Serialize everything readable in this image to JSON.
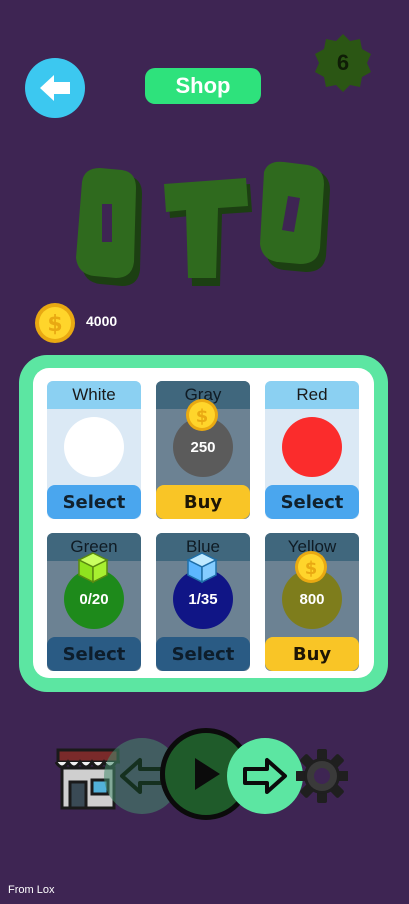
{
  "header": {
    "back_icon": "arrow-left-icon",
    "title": "Shop",
    "level": "6"
  },
  "logo": {
    "text": "OTO"
  },
  "balance": {
    "coins": "4000"
  },
  "colors": {
    "background": "#3e2553",
    "panel_border": "#5ce6a2",
    "select": "#4aa6ee",
    "buy": "#f9c526",
    "logo": "#2f6a1e"
  },
  "items": [
    {
      "name": "White",
      "swatch": "#ffffff",
      "value": "",
      "action": "Select",
      "locked": false,
      "badge": ""
    },
    {
      "name": "Gray",
      "swatch": "#5b5b5b",
      "value": "250",
      "action": "Buy",
      "locked": true,
      "badge": "coin-icon"
    },
    {
      "name": "Red",
      "swatch": "#fb2c2c",
      "value": "",
      "action": "Select",
      "locked": false,
      "badge": ""
    },
    {
      "name": "Green",
      "swatch": "#1e8a1b",
      "value": "0/20",
      "action": "Select",
      "locked": true,
      "badge": "green-cube-icon"
    },
    {
      "name": "Blue",
      "swatch": "#101586",
      "value": "1/35",
      "action": "Select",
      "locked": true,
      "badge": "blue-cube-icon"
    },
    {
      "name": "Yellow",
      "swatch": "#7e7d1c",
      "value": "800",
      "action": "Buy",
      "locked": true,
      "badge": "coin-icon"
    }
  ],
  "bottom_bar": {
    "store_icon": "store-icon",
    "prev_icon": "arrow-left-outline-icon",
    "play_icon": "play-icon",
    "next_icon": "arrow-right-outline-icon",
    "settings_icon": "gear-icon"
  },
  "footer": {
    "text": "From Lox"
  }
}
